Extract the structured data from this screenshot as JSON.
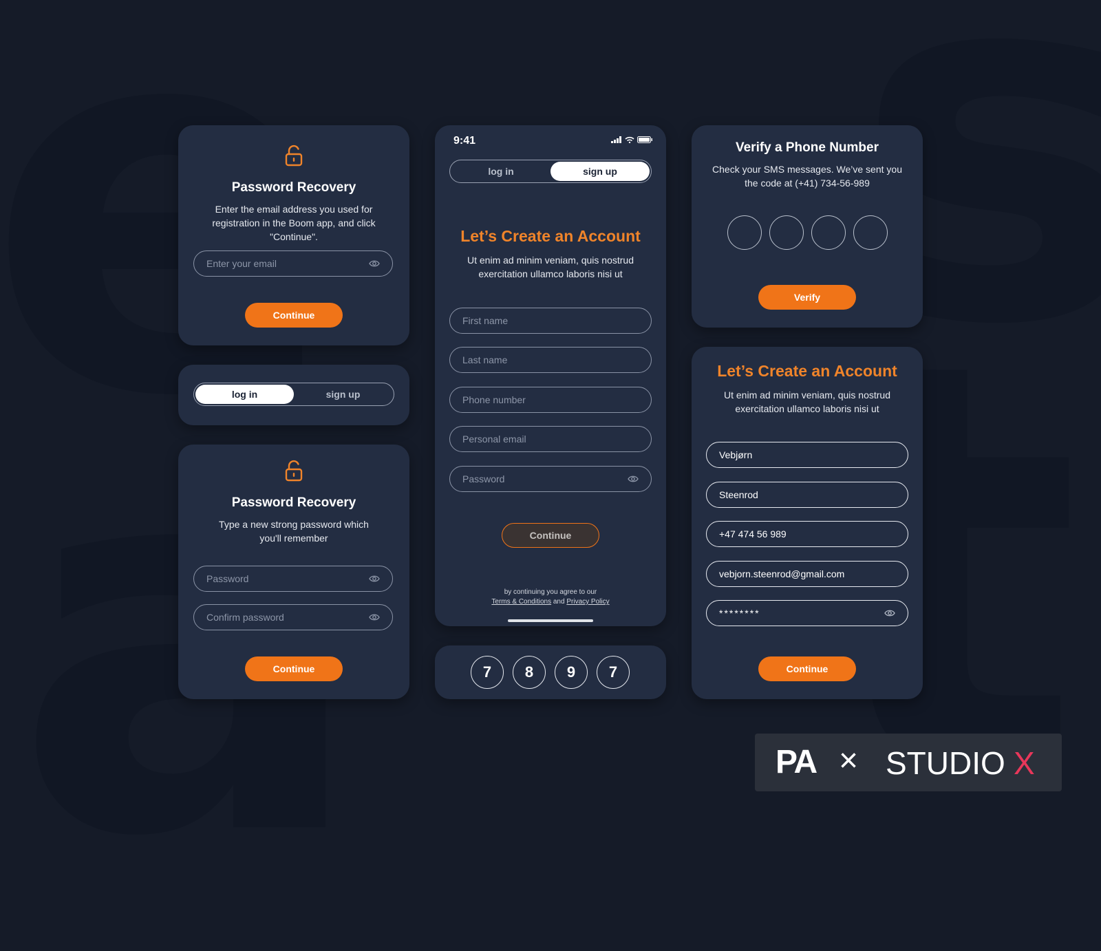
{
  "background": {
    "color": "#151b28",
    "letters": [
      "e",
      "s",
      "a",
      "t"
    ]
  },
  "colors": {
    "accent": "#f07418",
    "card": "#232d42",
    "brand_x": "#e8375a"
  },
  "recovery_email_card": {
    "icon": "lock-open-icon",
    "title": "Password Recovery",
    "description": "Enter the email address you used for registration in the Boom app, and click \"Continue\".",
    "email_placeholder": "Enter your email",
    "continue_label": "Continue"
  },
  "login_toggle_card": {
    "login_label": "log in",
    "signup_label": "sign up",
    "active": "log in"
  },
  "recovery_password_card": {
    "icon": "lock-open-icon",
    "title": "Password Recovery",
    "description": "Type a new strong password which you'll remember",
    "password_placeholder": "Password",
    "confirm_placeholder": "Confirm password",
    "continue_label": "Continue"
  },
  "signup_phone": {
    "status_time": "9:41",
    "login_label": "log in",
    "signup_label": "sign up",
    "active": "sign up",
    "title": "Let’s Create an Account",
    "description": "Ut enim ad minim veniam, quis nostrud exercitation ullamco laboris nisi ut",
    "fields": {
      "first_name": "First name",
      "last_name": "Last name",
      "phone": "Phone number",
      "email": "Personal email",
      "password": "Password"
    },
    "continue_label": "Continue",
    "legal_prefix": "by continuing you agree to our",
    "terms_label": "Terms & Conditions",
    "legal_and": "and",
    "privacy_label": "Privacy Policy"
  },
  "code_digits_card": {
    "digits": [
      "7",
      "8",
      "9",
      "7"
    ]
  },
  "verify_card": {
    "title": "Verify a Phone Number",
    "description": "Check your SMS messages. We’ve sent you the code at (+41) 734-56-989",
    "verify_label": "Verify"
  },
  "filled_signup_card": {
    "title": "Let’s Create an Account",
    "description": "Ut enim ad minim veniam, quis nostrud exercitation ullamco laboris nisi ut",
    "first_name": "Vebjørn",
    "last_name": "Steenrod",
    "phone": "+47 474 56 989",
    "email": "vebjorn.steenrod@gmail.com",
    "password": "********",
    "continue_label": "Continue"
  },
  "brand": {
    "left": "PA",
    "separator": "×",
    "right": "STUDIO",
    "x": "X"
  }
}
